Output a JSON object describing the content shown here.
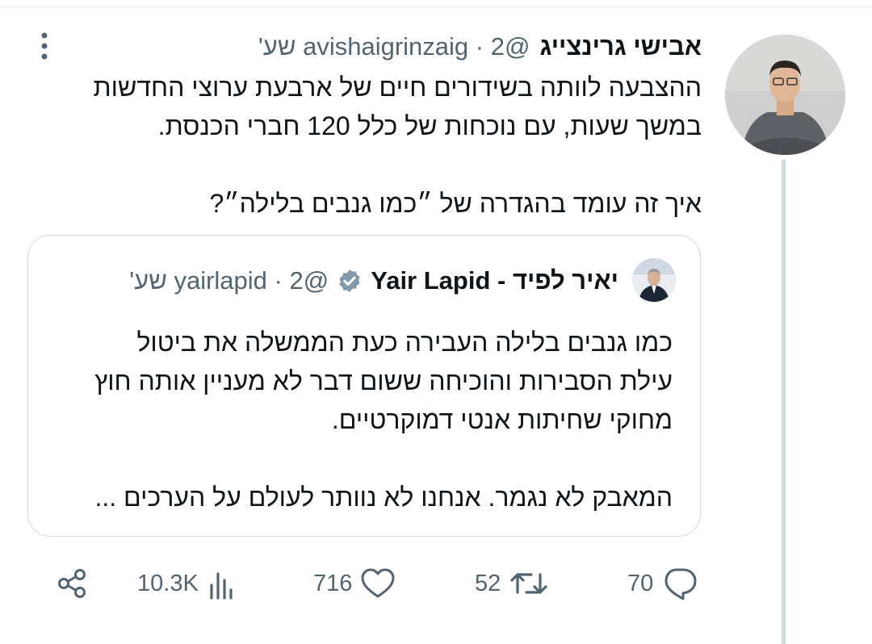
{
  "tweet": {
    "author_name": "אבישי גרינצייג",
    "handle": "@avishaigrinzaig",
    "time": "2 שע'",
    "separator": "·",
    "text_para1_line1": "ההצבעה לוותה בשידורים חיים של ארבעת ערוצי החדשות",
    "text_para1_line2": "במשך שעות, עם נוכחות של כלל 120 חברי הכנסת.",
    "text_para2": "איך זה עומד בהגדרה של ״כמו גנבים בלילה״?"
  },
  "quote": {
    "author_name": "יאיר לפיד - Yair Lapid",
    "handle": "@yairlapid",
    "time": "2 שע'",
    "separator": "·",
    "text_line1": "כמו גנבים בלילה העבירה כעת הממשלה את ביטול",
    "text_line2": "עילת הסבירות והוכיחה ששום דבר לא מעניין אותה חוץ",
    "text_line3": "מחוקי שחיתות אנטי דמוקרטיים.",
    "text_line4": "המאבק לא נגמר. אנחנו לא נוותר לעולם על הערכים ..."
  },
  "actions": {
    "replies": "70",
    "retweets": "52",
    "likes": "716",
    "views": "10.3K"
  },
  "icons": [
    "more-icon",
    "verified-badge-icon",
    "share-icon",
    "views-icon",
    "like-icon",
    "retweet-icon",
    "reply-icon"
  ],
  "colors": {
    "text": "#0f1419",
    "secondary": "#536471",
    "border": "#cfd9de",
    "badge": "#829aab"
  }
}
